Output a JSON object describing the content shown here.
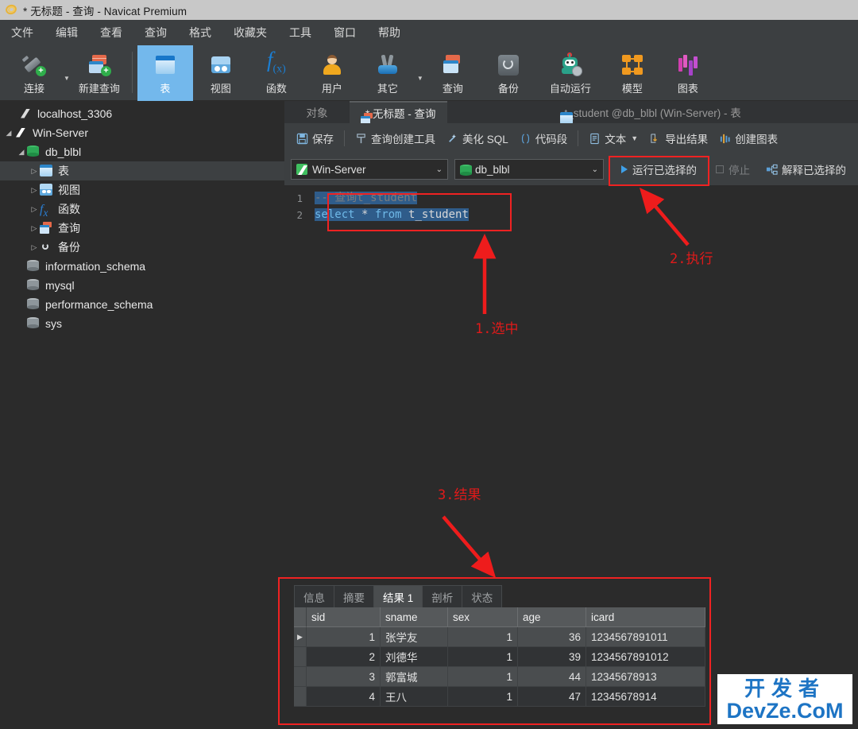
{
  "window": {
    "title": "* 无标题 - 查询 - Navicat Premium",
    "logo_icon": "navicat-logo-icon"
  },
  "menubar": {
    "items": [
      {
        "label": "文件"
      },
      {
        "label": "编辑"
      },
      {
        "label": "查看"
      },
      {
        "label": "查询"
      },
      {
        "label": "格式"
      },
      {
        "label": "收藏夹"
      },
      {
        "label": "工具"
      },
      {
        "label": "窗口"
      },
      {
        "label": "帮助"
      }
    ]
  },
  "toolbar": {
    "items": [
      {
        "label": "连接",
        "icon": "plug-plus-icon",
        "active": false,
        "caret": true
      },
      {
        "label": "新建查询",
        "icon": "new-query-icon",
        "active": false,
        "caret": false
      },
      {
        "label": "表",
        "icon": "table-icon",
        "active": true,
        "caret": false
      },
      {
        "label": "视图",
        "icon": "view-icon",
        "active": false,
        "caret": false
      },
      {
        "label": "函数",
        "icon": "function-fx-icon",
        "active": false,
        "caret": false
      },
      {
        "label": "用户",
        "icon": "user-icon",
        "active": false,
        "caret": false
      },
      {
        "label": "其它",
        "icon": "other-tools-icon",
        "active": false,
        "caret": true
      },
      {
        "label": "查询",
        "icon": "query-icon",
        "active": false,
        "caret": false
      },
      {
        "label": "备份",
        "icon": "backup-icon",
        "active": false,
        "caret": false
      },
      {
        "label": "自动运行",
        "icon": "automation-robot-icon",
        "active": false,
        "caret": false
      },
      {
        "label": "模型",
        "icon": "model-icon",
        "active": false,
        "caret": false
      },
      {
        "label": "图表",
        "icon": "chart-icon",
        "active": false,
        "caret": false
      }
    ]
  },
  "sidebar": {
    "items": [
      {
        "label": "localhost_3306",
        "icon": "connection-icon",
        "indent": 0,
        "twisty": "",
        "selected": false
      },
      {
        "label": "Win-Server",
        "icon": "connection-green-icon",
        "indent": 0,
        "twisty": "▲",
        "selected": false
      },
      {
        "label": "db_blbl",
        "icon": "database-green-icon",
        "indent": 1,
        "twisty": "▲",
        "selected": false
      },
      {
        "label": "表",
        "icon": "table-icon",
        "indent": 2,
        "twisty": "▷",
        "selected": true
      },
      {
        "label": "视图",
        "icon": "view-icon",
        "indent": 2,
        "twisty": "▷",
        "selected": false
      },
      {
        "label": "函数",
        "icon": "function-fx-icon",
        "indent": 2,
        "twisty": "▷",
        "selected": false
      },
      {
        "label": "查询",
        "icon": "query-icon",
        "indent": 2,
        "twisty": "▷",
        "selected": false
      },
      {
        "label": "备份",
        "icon": "backup-icon",
        "indent": 2,
        "twisty": "▷",
        "selected": false
      },
      {
        "label": "information_schema",
        "icon": "database-gray-icon",
        "indent": 1,
        "twisty": "",
        "selected": false
      },
      {
        "label": "mysql",
        "icon": "database-gray-icon",
        "indent": 1,
        "twisty": "",
        "selected": false
      },
      {
        "label": "performance_schema",
        "icon": "database-gray-icon",
        "indent": 1,
        "twisty": "",
        "selected": false
      },
      {
        "label": "sys",
        "icon": "database-gray-icon",
        "indent": 1,
        "twisty": "",
        "selected": false
      }
    ]
  },
  "tabs": {
    "object_tab": "对象",
    "items": [
      {
        "label": "* 无标题 - 查询",
        "icon": "query-icon",
        "active": true
      },
      {
        "label": "t_student @db_blbl (Win-Server) - 表",
        "icon": "table-icon",
        "active": false
      }
    ]
  },
  "query_toolbar": {
    "save": "保存",
    "query_builder": "查询创建工具",
    "beautify_sql": "美化 SQL",
    "snippet": "代码段",
    "text": "文本",
    "export_result": "导出结果",
    "create_chart": "创建图表"
  },
  "connection_bar": {
    "server": "Win-Server",
    "database": "db_blbl",
    "run_selected": "运行已选择的",
    "stop": "停止",
    "explain_selected": "解释已选择的"
  },
  "editor": {
    "line_numbers": [
      "1",
      "2"
    ],
    "line1_comment": "-- 查询t_student",
    "line2_tokens": [
      {
        "text": "select",
        "type": "keyword"
      },
      {
        "text": " * ",
        "type": "plain"
      },
      {
        "text": "from",
        "type": "keyword"
      },
      {
        "text": " t_student",
        "type": "plain"
      }
    ],
    "full_sql": "-- 查询t_student\nselect * from t_student"
  },
  "annotations": [
    {
      "id": "step-1",
      "text": "1.选中"
    },
    {
      "id": "step-2",
      "text": "2.执行"
    },
    {
      "id": "step-3",
      "text": "3.结果"
    }
  ],
  "results": {
    "tabs": [
      {
        "label": "信息",
        "active": false
      },
      {
        "label": "摘要",
        "active": false
      },
      {
        "label": "结果 1",
        "active": true
      },
      {
        "label": "剖析",
        "active": false
      },
      {
        "label": "状态",
        "active": false
      }
    ],
    "columns": [
      "sid",
      "sname",
      "sex",
      "age",
      "icard"
    ],
    "rows": [
      {
        "sid": "1",
        "sname": "张学友",
        "sex": "1",
        "age": "36",
        "icard": "1234567891011",
        "current": true
      },
      {
        "sid": "2",
        "sname": "刘德华",
        "sex": "1",
        "age": "39",
        "icard": "1234567891012",
        "current": false
      },
      {
        "sid": "3",
        "sname": "郭富城",
        "sex": "1",
        "age": "44",
        "icard": "12345678913",
        "current": false
      },
      {
        "sid": "4",
        "sname": "王八",
        "sex": "1",
        "age": "47",
        "icard": "12345678914",
        "current": false
      }
    ]
  },
  "watermark": {
    "line1": "开发者",
    "line2": "DevZe.CoM"
  },
  "colors": {
    "accent_blue": "#73b8ec",
    "annotation_red": "#e01a1a",
    "panel_bg": "#3c3f41",
    "app_bg": "#2b2b2b",
    "selection_blue": "#2f5c8a"
  }
}
